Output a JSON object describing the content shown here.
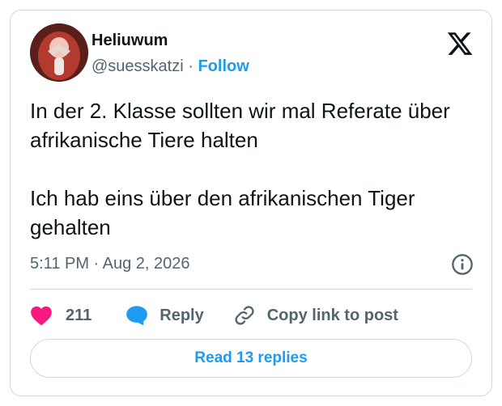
{
  "author": {
    "name": "Heliuwum",
    "handle": "@suesskatzi",
    "separator": "·",
    "follow_label": "Follow"
  },
  "tweet": {
    "text": "In der 2. Klasse sollten wir mal Referate über afrikanische Tiere halten\n\nIch hab eins über den afrikanischen Tiger gehalten",
    "timestamp": "5:11 PM · Aug 2, 2026"
  },
  "actions": {
    "like_count": "211",
    "reply_label": "Reply",
    "copy_link_label": "Copy link to post"
  },
  "footer": {
    "read_replies_label": "Read 13 replies"
  },
  "colors": {
    "accent": "#1d9bf0",
    "like": "#f91880",
    "secondary_text": "#536471",
    "border": "#cfd9de"
  },
  "icons": {
    "brand": "x-logo-icon",
    "info": "info-icon",
    "like": "heart-icon",
    "reply": "speech-bubble-icon",
    "copy": "link-icon"
  }
}
